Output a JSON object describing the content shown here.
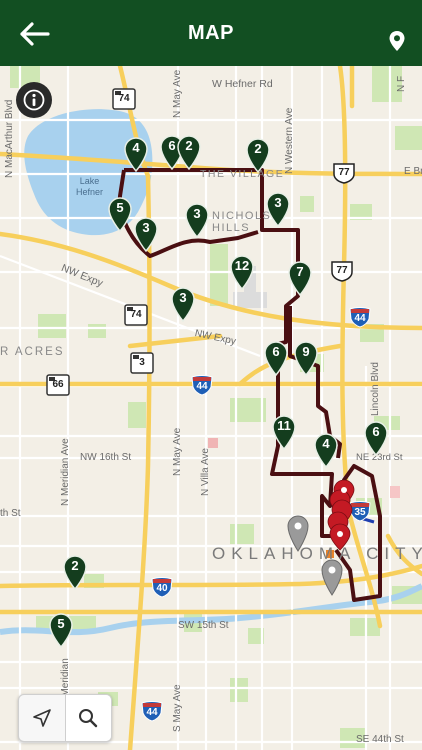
{
  "header": {
    "title": "MAP",
    "back_icon": "back-arrow-icon",
    "location_icon": "location-pin-icon",
    "background": "#124f22"
  },
  "map": {
    "labels": {
      "macarthur": "N MacArthur Blvd",
      "may_top": "N May Ave",
      "hefner": "W Hefner Rd",
      "western": "N Western Ave",
      "lake": "Lake\nHefner",
      "village": "THE VILLAGE",
      "e_br": "E Br",
      "nichols": "NICHOLS\nHILLS",
      "nw_expy": "NW Expy",
      "nw_expy2": "NW Expy",
      "acres": "R ACRES",
      "lincoln": "Lincoln Blvd",
      "may_mid": "N May Ave",
      "villa": "N Villa Ave",
      "meridian": "N Meridian Ave",
      "nw16": "NW 16th St",
      "nw23": "NE 23rd St",
      "th_st": "th St",
      "city": "OKLAHOMA CITY",
      "sw15": "SW 15th St",
      "s_meridian": "S Meridian",
      "s_may": "S May Ave",
      "se44": "SE 44th St",
      "n_f": "N F"
    },
    "shields": [
      {
        "text": "74",
        "type": "state"
      },
      {
        "text": "77",
        "type": "us"
      },
      {
        "text": "77",
        "type": "us"
      },
      {
        "text": "44",
        "type": "interstate"
      },
      {
        "text": "74",
        "type": "state"
      },
      {
        "text": "3",
        "type": "state"
      },
      {
        "text": "66",
        "type": "state"
      },
      {
        "text": "44",
        "type": "interstate"
      },
      {
        "text": "40",
        "type": "interstate"
      },
      {
        "text": "44",
        "type": "interstate"
      },
      {
        "text": "35",
        "type": "interstate"
      }
    ],
    "markers": [
      {
        "label": "4"
      },
      {
        "label": "6"
      },
      {
        "label": "2"
      },
      {
        "label": "2"
      },
      {
        "label": "5"
      },
      {
        "label": "3"
      },
      {
        "label": "3"
      },
      {
        "label": "3"
      },
      {
        "label": "12"
      },
      {
        "label": "7"
      },
      {
        "label": "3"
      },
      {
        "label": "6"
      },
      {
        "label": "9"
      },
      {
        "label": "11"
      },
      {
        "label": "4"
      },
      {
        "label": "6"
      },
      {
        "label": "2"
      },
      {
        "label": "5"
      }
    ],
    "route_color": "#4a0f12",
    "marker_color": "#143d1e",
    "red_pin_color": "#c41a24",
    "gray_pin_color": "#9a9a9a"
  },
  "controls": {
    "info_icon": "info-icon",
    "locate_icon": "navigation-arrow-icon",
    "search_icon": "search-icon"
  }
}
